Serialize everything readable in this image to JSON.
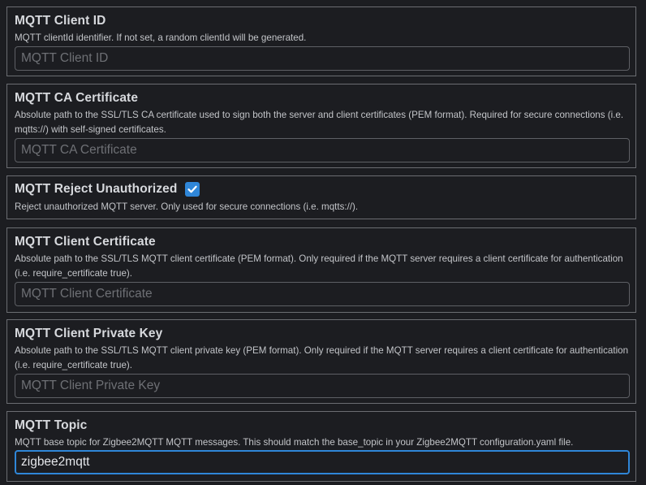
{
  "client_id": {
    "title": "MQTT Client ID",
    "description": "MQTT clientId identifier. If not set, a random clientId will be generated.",
    "placeholder": "MQTT Client ID",
    "value": ""
  },
  "ca_certificate": {
    "title": "MQTT CA Certificate",
    "description": "Absolute path to the SSL/TLS CA certificate used to sign both the server and client certificates (PEM format). Required for secure connections (i.e. mqtts://) with self-signed certificates.",
    "placeholder": "MQTT CA Certificate",
    "value": ""
  },
  "reject_unauthorized": {
    "title": "MQTT Reject Unauthorized",
    "description": "Reject unauthorized MQTT server. Only used for secure connections (i.e. mqtts://).",
    "checked": true
  },
  "client_certificate": {
    "title": "MQTT Client Certificate",
    "description": "Absolute path to the SSL/TLS MQTT client certificate (PEM format). Only required if the MQTT server requires a client certificate for authentication (i.e. require_certificate true).",
    "placeholder": "MQTT Client Certificate",
    "value": ""
  },
  "client_private_key": {
    "title": "MQTT Client Private Key",
    "description": "Absolute path to the SSL/TLS MQTT client private key (PEM format). Only required if the MQTT server requires a client certificate for authentication (i.e. require_certificate true).",
    "placeholder": "MQTT Client Private Key",
    "value": ""
  },
  "topic": {
    "title": "MQTT Topic",
    "description": "MQTT base topic for Zigbee2MQTT MQTT messages. This should match the base_topic in your Zigbee2MQTT configuration.yaml file.",
    "placeholder": "MQTT Topic",
    "value": "zigbee2mqtt"
  },
  "colors": {
    "background": "#1c1d21",
    "border": "#6b6d72",
    "accent": "#2f86d8"
  }
}
